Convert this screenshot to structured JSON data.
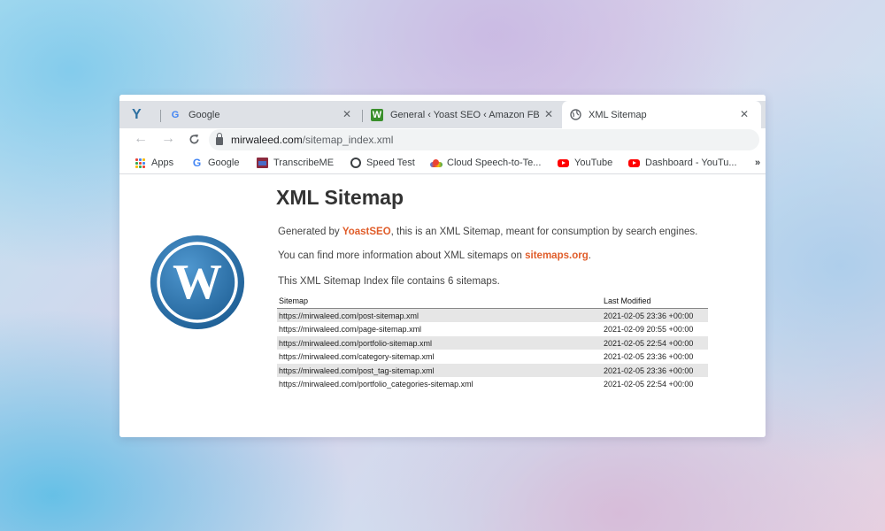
{
  "browser": {
    "pinned_tab": {
      "icon": "yoast-y-icon"
    },
    "tabs": [
      {
        "title": "Google",
        "icon": "google-icon",
        "active": false
      },
      {
        "title": "General ‹ Yoast SEO ‹ Amazon FB",
        "icon": "yoast-w-icon",
        "active": false
      },
      {
        "title": "XML Sitemap",
        "icon": "globe-icon",
        "active": true
      }
    ],
    "address": {
      "domain": "mirwaleed.com",
      "path": "/sitemap_index.xml"
    },
    "bookmarks": [
      {
        "label": "Apps",
        "icon": "apps-grid-icon"
      },
      {
        "label": "Google",
        "icon": "google-icon"
      },
      {
        "label": "TranscribeME",
        "icon": "transcribeme-icon"
      },
      {
        "label": "Speed Test",
        "icon": "speedtest-icon"
      },
      {
        "label": "Cloud Speech-to-Te...",
        "icon": "cloud-icon"
      },
      {
        "label": "YouTube",
        "icon": "youtube-icon"
      },
      {
        "label": "Dashboard - YouTu...",
        "icon": "youtube-icon"
      }
    ]
  },
  "page": {
    "title": "XML Sitemap",
    "generated": {
      "prefix": "Generated by ",
      "link": "YoastSEO",
      "suffix": ", this is an XML Sitemap, meant for consumption by search engines."
    },
    "info": {
      "prefix": "You can find more information about XML sitemaps on ",
      "link": "sitemaps.org",
      "suffix": "."
    },
    "count_text": "This XML Sitemap Index file contains 6 sitemaps.",
    "table": {
      "headers": {
        "sitemap": "Sitemap",
        "modified": "Last Modified"
      },
      "rows": [
        {
          "url": "https://mirwaleed.com/post-sitemap.xml",
          "modified": "2021-02-05 23:36 +00:00"
        },
        {
          "url": "https://mirwaleed.com/page-sitemap.xml",
          "modified": "2021-02-09 20:55 +00:00"
        },
        {
          "url": "https://mirwaleed.com/portfolio-sitemap.xml",
          "modified": "2021-02-05 22:54 +00:00"
        },
        {
          "url": "https://mirwaleed.com/category-sitemap.xml",
          "modified": "2021-02-05 23:36 +00:00"
        },
        {
          "url": "https://mirwaleed.com/post_tag-sitemap.xml",
          "modified": "2021-02-05 23:36 +00:00"
        },
        {
          "url": "https://mirwaleed.com/portfolio_categories-sitemap.xml",
          "modified": "2021-02-05 22:54 +00:00"
        }
      ]
    }
  },
  "colors": {
    "link": "#e05d2a",
    "wordpress_blue": "#3276b1",
    "tabstrip": "#dee1e6"
  }
}
